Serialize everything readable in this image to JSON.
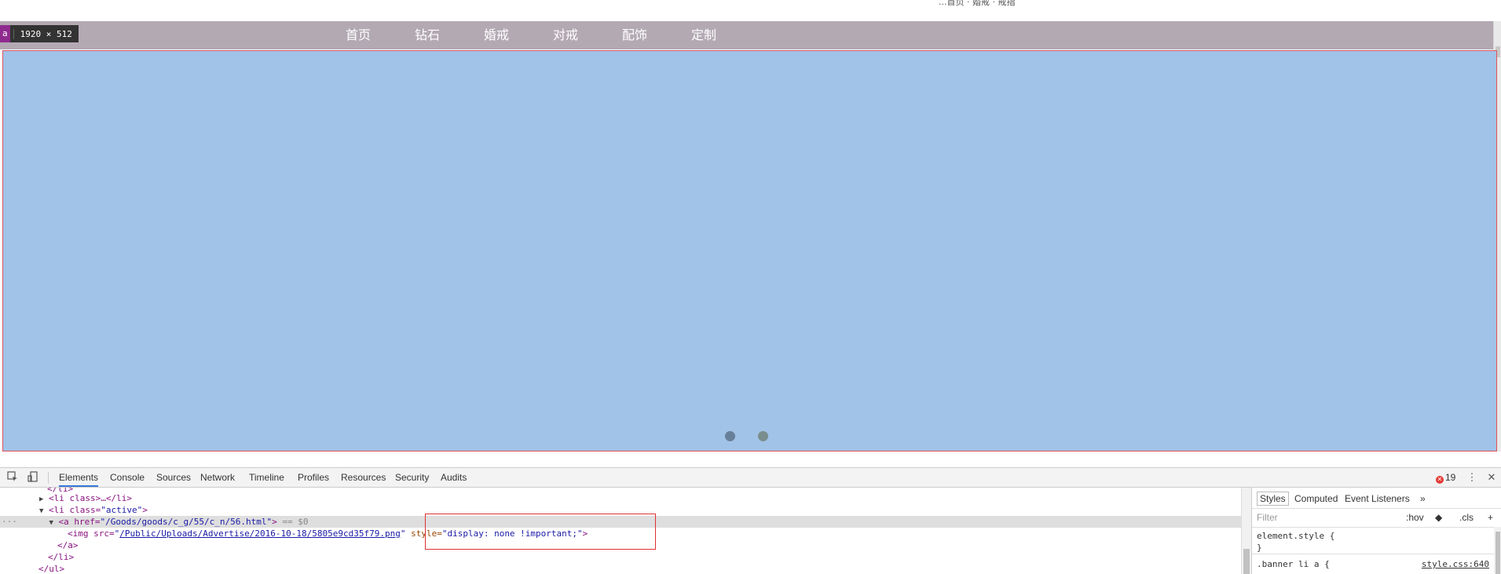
{
  "top_hint": "...首页 · 婚戒 · 戒指",
  "nav": {
    "items": [
      "首页",
      "钻石",
      "婚戒",
      "对戒",
      "配饰",
      "定制"
    ]
  },
  "size_tag": {
    "letter": "a",
    "dims": "1920 × 512"
  },
  "devtools": {
    "tabs": [
      "Elements",
      "Console",
      "Sources",
      "Network",
      "Timeline",
      "Profiles",
      "Resources",
      "Security",
      "Audits"
    ],
    "error_count": "19",
    "icons": {
      "inspect": "inspect-icon",
      "device": "device-mode-icon",
      "more": "more-vert-icon",
      "close": "close-icon"
    },
    "code": {
      "l0": "</li>",
      "l1_tag_open": "<li class",
      "l1_rest": ">…</li>",
      "l2_tag": "<li class=",
      "l2_val": "\"active\"",
      "l2_close": ">",
      "l3_tag": "<a href=",
      "l3_val": "\"/Goods/goods/c_g/55/c_n/56.html\"",
      "l3_close": ">",
      "l3_marker": " == $0",
      "l4_tag": "<img src=",
      "l4_link": "/Public/Uploads/Advertise/2016-10-18/5805e9cd35f79.png",
      "l4_attr": " style=",
      "l4_val": "\"display: none !important;\"",
      "l4_close": ">",
      "l5": "</a>",
      "l6": "</li>",
      "l7": "</ul>"
    },
    "styles": {
      "tabs": [
        "Styles",
        "Computed",
        "Event Listeners"
      ],
      "more": "»",
      "filter_placeholder": "Filter",
      "hov": ":hov",
      "cls": ".cls",
      "plus": "+",
      "element_style_open": "element.style {",
      "element_style_close": "}",
      "rule_selector": ".banner li a {",
      "rule_source": "style.css:640"
    }
  }
}
